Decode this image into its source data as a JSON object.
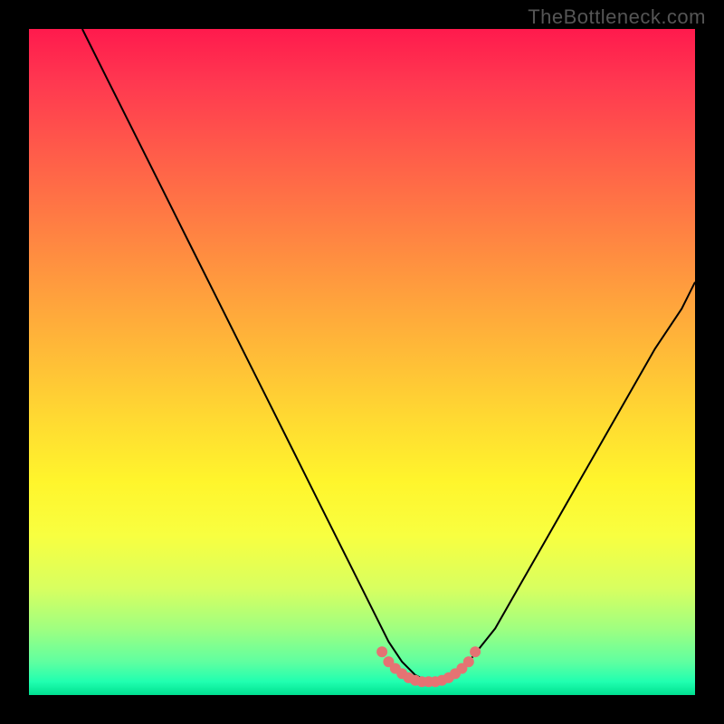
{
  "watermark": "TheBottleneck.com",
  "chart_data": {
    "type": "line",
    "title": "",
    "xlabel": "",
    "ylabel": "",
    "xlim": [
      0,
      100
    ],
    "ylim": [
      0,
      100
    ],
    "series": [
      {
        "name": "bottleneck-curve",
        "x": [
          8,
          12,
          16,
          20,
          24,
          28,
          32,
          36,
          40,
          44,
          48,
          52,
          54,
          56,
          58,
          60,
          62,
          64,
          66,
          70,
          74,
          78,
          82,
          86,
          90,
          94,
          98,
          100
        ],
        "y": [
          100,
          92,
          84,
          76,
          68,
          60,
          52,
          44,
          36,
          28,
          20,
          12,
          8,
          5,
          3,
          2,
          2,
          3,
          5,
          10,
          17,
          24,
          31,
          38,
          45,
          52,
          58,
          62
        ]
      }
    ],
    "highlight": {
      "name": "optimal-range-dots",
      "x": [
        53,
        54,
        55,
        56,
        57,
        58,
        59,
        60,
        61,
        62,
        63,
        64,
        65,
        66,
        67
      ],
      "y": [
        6.5,
        5,
        4,
        3.2,
        2.6,
        2.2,
        2,
        2,
        2,
        2.2,
        2.6,
        3.2,
        4,
        5,
        6.5
      ]
    },
    "background_gradient": {
      "top": "#ff1a4d",
      "mid_upper": "#ff9a3e",
      "mid": "#ffd832",
      "mid_lower": "#f8ff40",
      "bottom": "#00e090"
    }
  }
}
